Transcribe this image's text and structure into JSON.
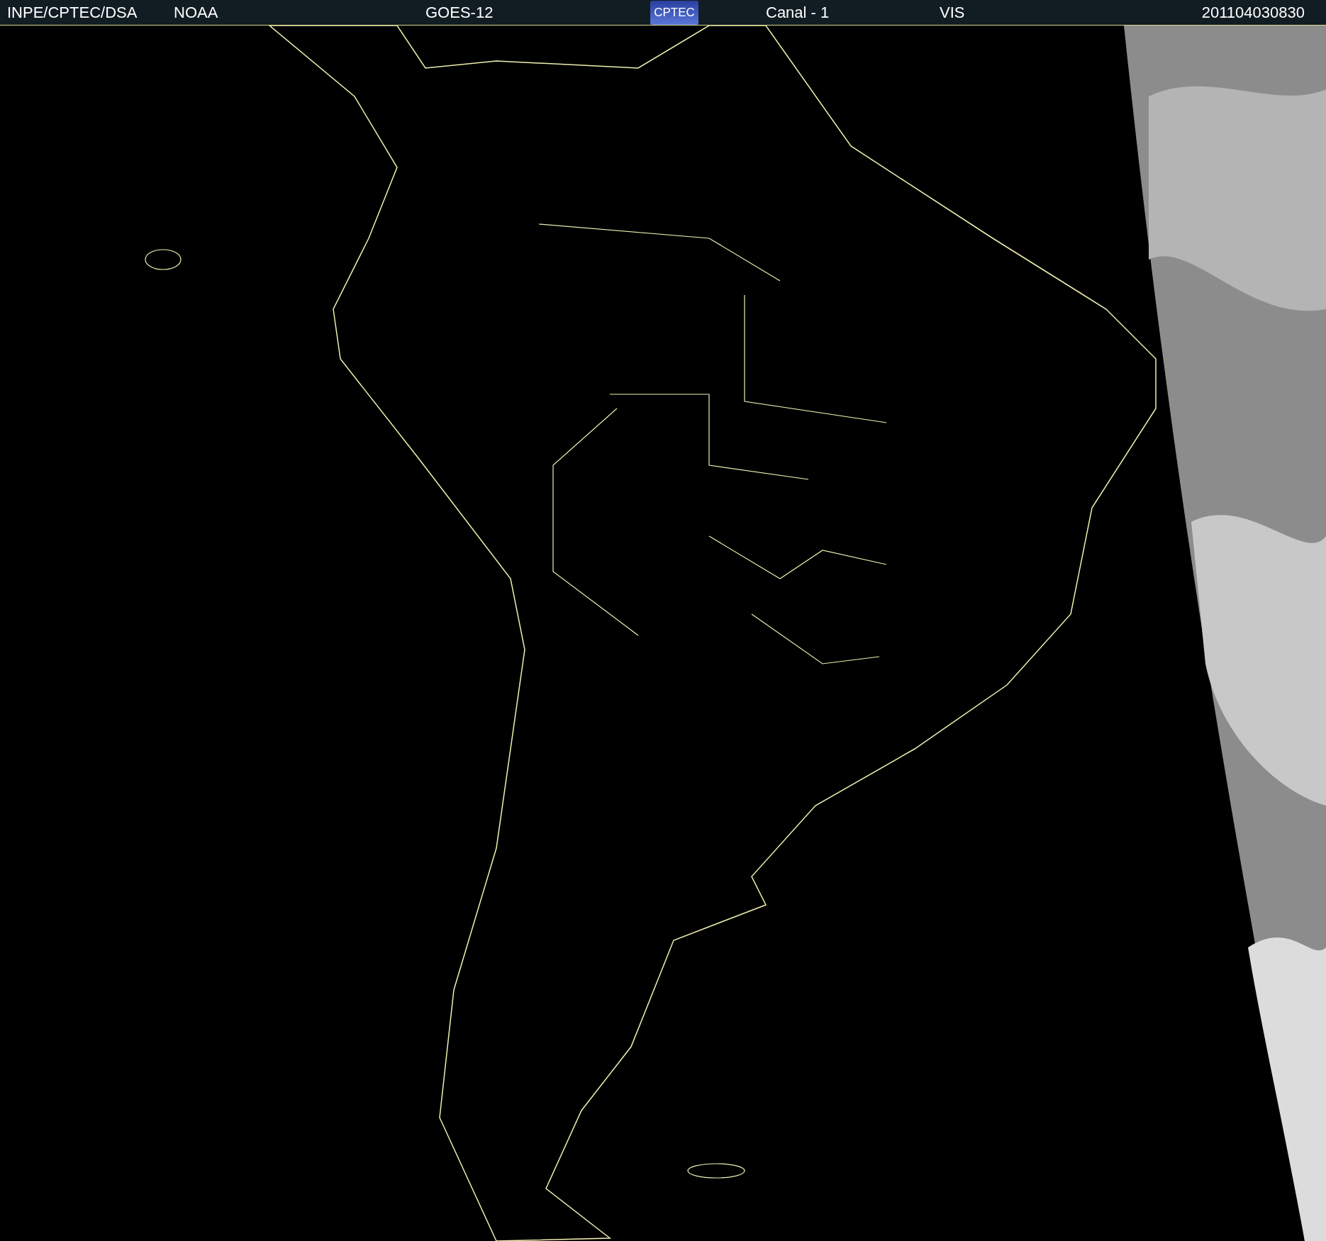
{
  "header": {
    "source": "INPE/CPTEC/DSA",
    "agency": "NOAA",
    "satellite": "GOES-12",
    "logo_text": "CPTEC",
    "channel": "Canal - 1",
    "band": "VIS",
    "timestamp": "201104030830"
  }
}
